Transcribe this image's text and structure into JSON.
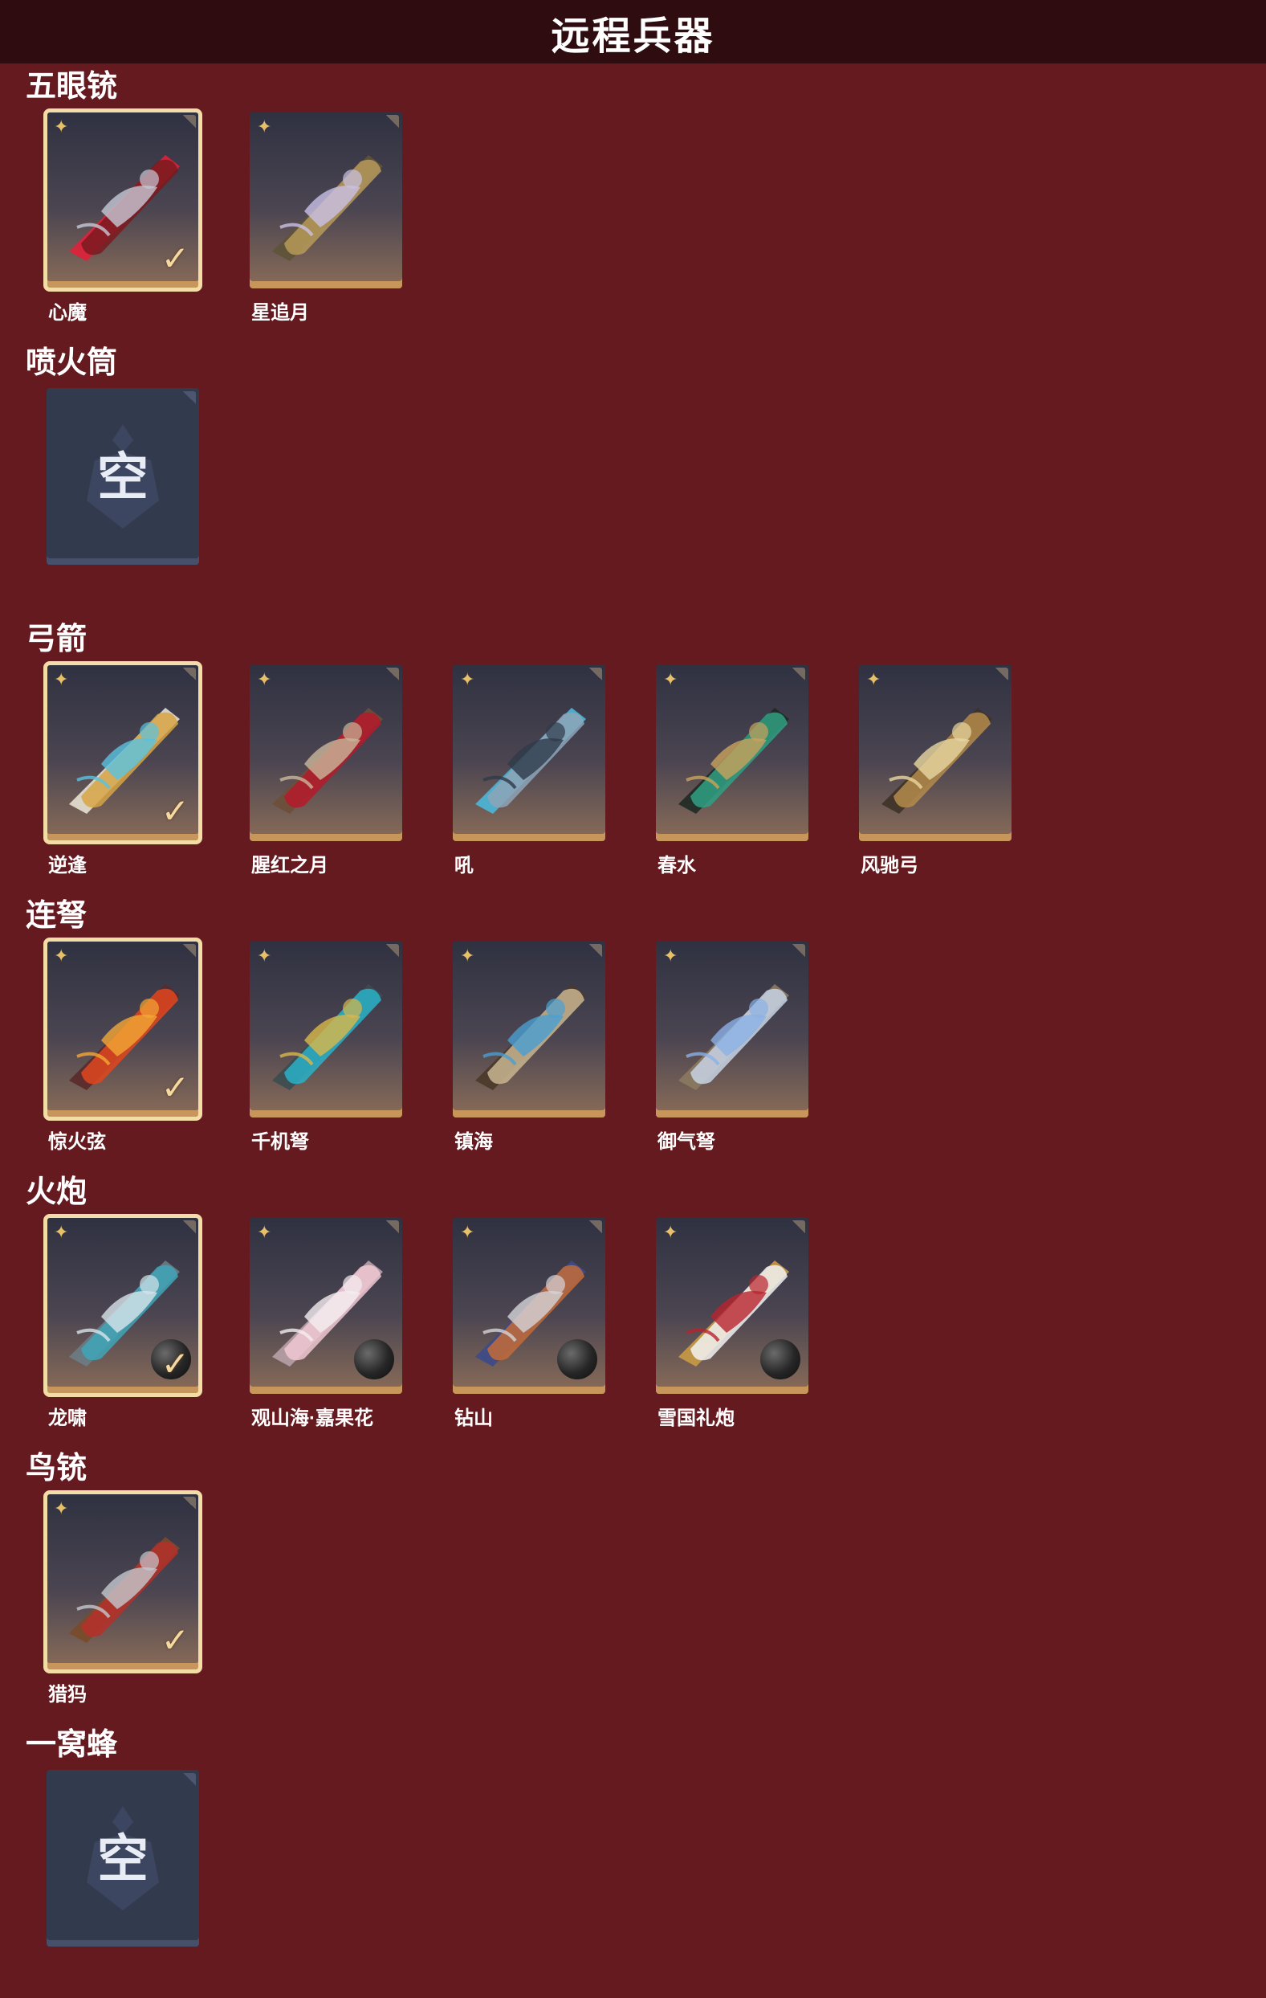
{
  "header": {
    "title": "远程兵器"
  },
  "empty_label": "空",
  "colors": {
    "background": "#641a1f",
    "header": "#2e0c10",
    "selected_border": "#f3dca5",
    "rarity_star": "#e9c06a",
    "card_bottom": "#c8965b"
  },
  "sections": [
    {
      "title": "五眼铳",
      "items": [
        {
          "name": "心魔",
          "selected": true,
          "ammo": false,
          "palette": [
            "#7a1a1e",
            "#c5c9d6",
            "#e0203a"
          ]
        },
        {
          "name": "星追月",
          "selected": false,
          "ammo": false,
          "palette": [
            "#b79a5a",
            "#c9c0e6",
            "#5e5338"
          ]
        }
      ]
    },
    {
      "title": "喷火筒",
      "items": [
        {
          "empty": true
        }
      ]
    },
    {
      "title": "弓箭",
      "items": [
        {
          "name": "逆逢",
          "selected": true,
          "ammo": false,
          "palette": [
            "#d7a445",
            "#5ac2e0",
            "#e6e1d2"
          ]
        },
        {
          "name": "腥红之月",
          "selected": false,
          "ammo": false,
          "palette": [
            "#b51a2c",
            "#c9b79b",
            "#6d4f3a"
          ]
        },
        {
          "name": "吼",
          "selected": false,
          "ammo": false,
          "palette": [
            "#8da4b8",
            "#2f3a48",
            "#4bb7d8"
          ]
        },
        {
          "name": "春水",
          "selected": false,
          "ammo": false,
          "palette": [
            "#2fa083",
            "#c9a25c",
            "#1e2a24"
          ]
        },
        {
          "name": "风驰弓",
          "selected": false,
          "ammo": false,
          "palette": [
            "#b48b4b",
            "#e8d7a0",
            "#3e3328"
          ]
        }
      ]
    },
    {
      "title": "连弩",
      "items": [
        {
          "name": "惊火弦",
          "selected": true,
          "ammo": false,
          "palette": [
            "#e0461e",
            "#f4a836",
            "#5a2a2a"
          ]
        },
        {
          "name": "千机弩",
          "selected": false,
          "ammo": false,
          "palette": [
            "#2ab1c8",
            "#d9b84a",
            "#3b4d50"
          ]
        },
        {
          "name": "镇海",
          "selected": false,
          "ammo": false,
          "palette": [
            "#c9b58f",
            "#4a9fd2",
            "#4a3a2a"
          ]
        },
        {
          "name": "御气弩",
          "selected": false,
          "ammo": false,
          "palette": [
            "#c8d3e4",
            "#8bb0e6",
            "#8b7a60"
          ]
        }
      ]
    },
    {
      "title": "火炮",
      "items": [
        {
          "name": "龙啸",
          "selected": true,
          "ammo": true,
          "palette": [
            "#3fa6b8",
            "#d7e4ea",
            "#6b7c86"
          ]
        },
        {
          "name": "观山海·嘉果花",
          "selected": false,
          "ammo": true,
          "palette": [
            "#f0c8d2",
            "#f4eef0",
            "#b8a0a8"
          ]
        },
        {
          "name": "钻山",
          "selected": false,
          "ammo": true,
          "palette": [
            "#c26b3a",
            "#d4d4d8",
            "#3d4a8a"
          ]
        },
        {
          "name": "雪国礼炮",
          "selected": false,
          "ammo": true,
          "palette": [
            "#f2f2f2",
            "#b8232f",
            "#c99a45"
          ]
        }
      ]
    },
    {
      "title": "鸟铳",
      "items": [
        {
          "name": "猎犸",
          "selected": true,
          "ammo": false,
          "palette": [
            "#b5302a",
            "#c4c8d0",
            "#7a4a2a"
          ]
        }
      ]
    },
    {
      "title": "一窝蜂",
      "items": [
        {
          "empty": true
        }
      ]
    }
  ]
}
